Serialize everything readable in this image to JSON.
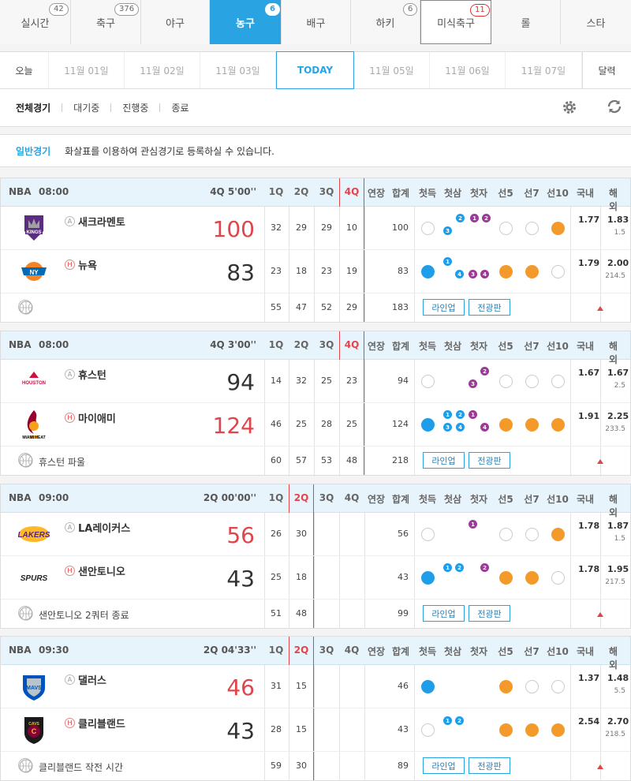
{
  "sport_tabs": [
    {
      "label": "실시간",
      "badge": "42"
    },
    {
      "label": "축구",
      "badge": "376"
    },
    {
      "label": "야구",
      "badge": ""
    },
    {
      "label": "농구",
      "badge": "6"
    },
    {
      "label": "배구",
      "badge": ""
    },
    {
      "label": "하키",
      "badge": "6"
    },
    {
      "label": "미식축구",
      "badge": "11"
    },
    {
      "label": "롤",
      "badge": ""
    },
    {
      "label": "스타",
      "badge": ""
    }
  ],
  "dates": [
    "오늘",
    "11월 01일",
    "11월 02일",
    "11월 03일",
    "TODAY",
    "11월 05일",
    "11월 06일",
    "11월 07일",
    "달력"
  ],
  "filters": [
    "전체경기",
    "대기중",
    "진행중",
    "종료"
  ],
  "notice": {
    "label": "일반경기",
    "text": "화살표를 이용하여 관심경기로 등록하실 수 있습니다."
  },
  "columns": [
    "1Q",
    "2Q",
    "3Q",
    "4Q",
    "연장",
    "합계",
    "첫득",
    "첫삼",
    "첫자",
    "선5",
    "선7",
    "선10",
    "국내",
    "해외"
  ],
  "buttons": {
    "lineup": "라인업",
    "commentary": "전광판"
  },
  "games": [
    {
      "league": "NBA",
      "time": "08:00",
      "status": "4Q 5'00''",
      "current": "4Q",
      "home": {
        "name": "새크라멘토",
        "ha": "A",
        "logo": "kings-logo",
        "score": "100",
        "win": true,
        "q": [
          "32",
          "29",
          "29",
          "10"
        ],
        "total": "100",
        "dom": "1.77",
        "ovs": "1.83",
        "hc": "1.5"
      },
      "away": {
        "name": "뉴욕",
        "ha": "H",
        "logo": "knicks-logo",
        "score": "83",
        "win": false,
        "q": [
          "23",
          "18",
          "23",
          "19"
        ],
        "total": "83",
        "dom": "1.79",
        "ovs": "2.00",
        "hc": "214.5"
      },
      "foot": {
        "text": "",
        "q": [
          "55",
          "47",
          "52",
          "29"
        ],
        "total": "183"
      }
    },
    {
      "league": "NBA",
      "time": "08:00",
      "status": "4Q 3'00''",
      "current": "4Q",
      "home": {
        "name": "휴스턴",
        "ha": "A",
        "logo": "rockets-logo",
        "score": "94",
        "win": false,
        "q": [
          "14",
          "32",
          "25",
          "23"
        ],
        "total": "94",
        "dom": "1.67",
        "ovs": "1.67",
        "hc": "2.5"
      },
      "away": {
        "name": "마이애미",
        "ha": "H",
        "logo": "heat-logo",
        "score": "124",
        "win": true,
        "q": [
          "46",
          "25",
          "28",
          "25"
        ],
        "total": "124",
        "dom": "1.91",
        "ovs": "2.25",
        "hc": "233.5"
      },
      "foot": {
        "text": "휴스턴 파울",
        "q": [
          "60",
          "57",
          "53",
          "48"
        ],
        "total": "218"
      }
    },
    {
      "league": "NBA",
      "time": "09:00",
      "status": "2Q 00'00''",
      "current": "2Q",
      "home": {
        "name": "LA레이커스",
        "ha": "A",
        "logo": "lakers-logo",
        "score": "56",
        "win": true,
        "q": [
          "26",
          "30",
          "",
          ""
        ],
        "total": "56",
        "dom": "1.78",
        "ovs": "1.87",
        "hc": "1.5"
      },
      "away": {
        "name": "샌안토니오",
        "ha": "H",
        "logo": "spurs-logo",
        "score": "43",
        "win": false,
        "q": [
          "25",
          "18",
          "",
          ""
        ],
        "total": "43",
        "dom": "1.78",
        "ovs": "1.95",
        "hc": "217.5"
      },
      "foot": {
        "text": "샌안토니오 2쿼터 종료",
        "q": [
          "51",
          "48",
          "",
          ""
        ],
        "total": "99"
      }
    },
    {
      "league": "NBA",
      "time": "09:30",
      "status": "2Q 04'33''",
      "current": "2Q",
      "home": {
        "name": "댈러스",
        "ha": "A",
        "logo": "mavericks-logo",
        "score": "46",
        "win": true,
        "q": [
          "31",
          "15",
          "",
          ""
        ],
        "total": "46",
        "dom": "1.37",
        "ovs": "1.48",
        "hc": "5.5"
      },
      "away": {
        "name": "클리블랜드",
        "ha": "H",
        "logo": "cavaliers-logo",
        "score": "43",
        "win": false,
        "q": [
          "28",
          "15",
          "",
          ""
        ],
        "total": "43",
        "dom": "2.54",
        "ovs": "2.70",
        "hc": "218.5"
      },
      "foot": {
        "text": "클리블랜드 작전 시간",
        "q": [
          "59",
          "30",
          "",
          ""
        ],
        "total": "89"
      }
    }
  ]
}
